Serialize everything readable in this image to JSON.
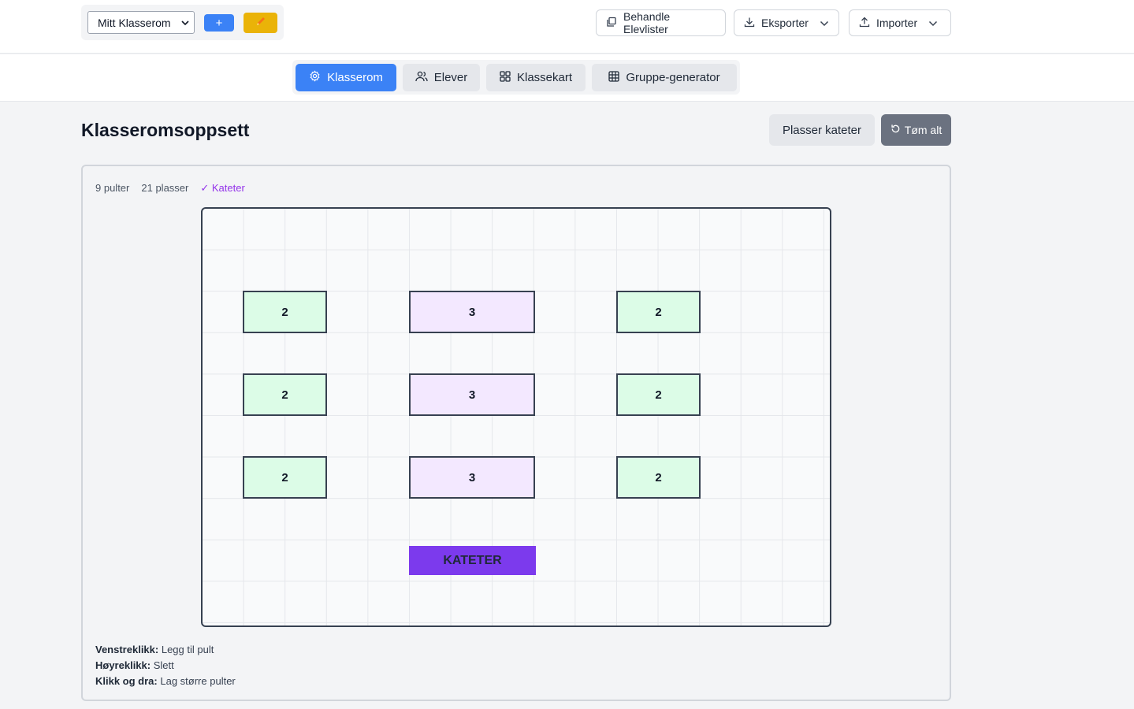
{
  "header": {
    "class_select": "Mitt Klasserom",
    "add_label": "+",
    "manage_lists": "Behandle Elevlister",
    "export": "Eksporter",
    "import": "Importer"
  },
  "tabs": [
    {
      "label": "Klasserom",
      "active": true,
      "icon": "gear-icon"
    },
    {
      "label": "Elever",
      "active": false,
      "icon": "users-icon"
    },
    {
      "label": "Klassekart",
      "active": false,
      "icon": "grid-icon"
    },
    {
      "label": "Gruppe-generator",
      "active": false,
      "icon": "table-icon"
    }
  ],
  "main": {
    "title": "Klasseromsoppsett",
    "place_teacher": "Plasser kateter",
    "clear_all": "Tøm alt"
  },
  "stats": {
    "desks": "9 pulter",
    "seats": "21 plasser",
    "teacher": "✓ Kateter"
  },
  "desks": [
    {
      "seats": "2"
    },
    {
      "seats": "3"
    },
    {
      "seats": "2"
    },
    {
      "seats": "2"
    },
    {
      "seats": "3"
    },
    {
      "seats": "2"
    },
    {
      "seats": "2"
    },
    {
      "seats": "3"
    },
    {
      "seats": "2"
    }
  ],
  "teacher_desk": "KATETER",
  "help": {
    "left_key": "Venstreklikk:",
    "left_text": "Legg til pult",
    "right_key": "Høyreklikk:",
    "right_text": "Slett",
    "drag_key": "Klikk og dra:",
    "drag_text": "Lag større pulter"
  },
  "colors": {
    "primary": "#3b82f6",
    "edit": "#eab308",
    "desk_two": "#dcfce7",
    "desk_three": "#f3e8ff",
    "teacher": "#7c3aed"
  }
}
